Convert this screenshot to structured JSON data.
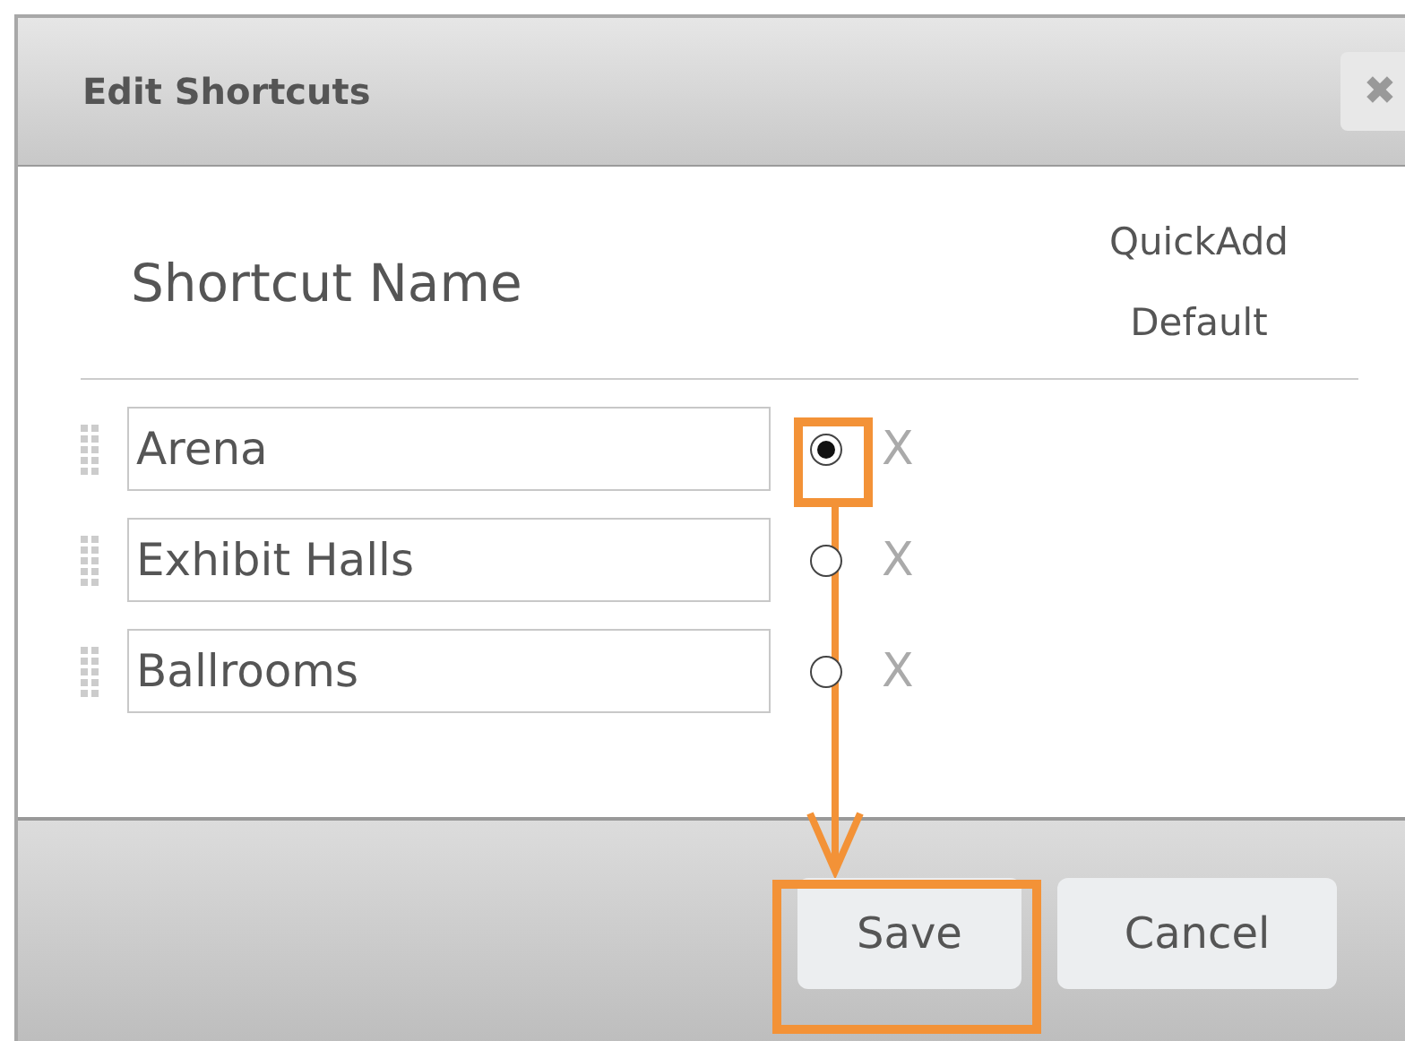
{
  "dialog": {
    "title": "Edit Shortcuts",
    "close": "✖"
  },
  "columns": [
    "Shortcut Name",
    "QuickAdd Default"
  ],
  "rows": [
    {
      "name": "Arena",
      "selected": true,
      "remove": "X"
    },
    {
      "name": "Exhibit Halls",
      "selected": false,
      "remove": "X"
    },
    {
      "name": "Ballrooms",
      "selected": false,
      "remove": "X"
    }
  ],
  "buttons": [
    "Save",
    "Cancel"
  ]
}
